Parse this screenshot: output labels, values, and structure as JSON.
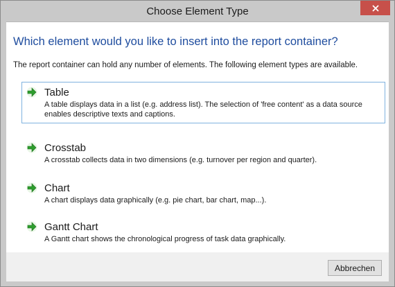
{
  "window": {
    "title": "Choose Element Type"
  },
  "main": {
    "heading": "Which element would you like to insert into the report container?",
    "description": "The report container can hold any number of elements. The following element types are available.",
    "options": [
      {
        "title": "Table",
        "description": "A table displays data in a list (e.g. address list). The selection of 'free content' as a data source enables descriptive texts and captions.",
        "icon": "green-arrow-icon",
        "selected": true
      },
      {
        "title": "Crosstab",
        "description": "A crosstab collects data in two dimensions (e.g. turnover per region and quarter).",
        "icon": "green-arrow-icon",
        "selected": false
      },
      {
        "title": "Chart",
        "description": "A chart displays data graphically (e.g. pie chart, bar chart, map...).",
        "icon": "green-arrow-icon",
        "selected": false
      },
      {
        "title": "Gantt Chart",
        "description": "A Gantt chart shows the chronological progress of task data graphically.",
        "icon": "green-arrow-icon",
        "selected": false
      }
    ]
  },
  "footer": {
    "cancel_label": "Abbrechen"
  },
  "colors": {
    "heading": "#1e4c9e",
    "close_button": "#c7504a",
    "selection_border": "#7fb2df",
    "arrow_green": "#2e9e2e"
  }
}
